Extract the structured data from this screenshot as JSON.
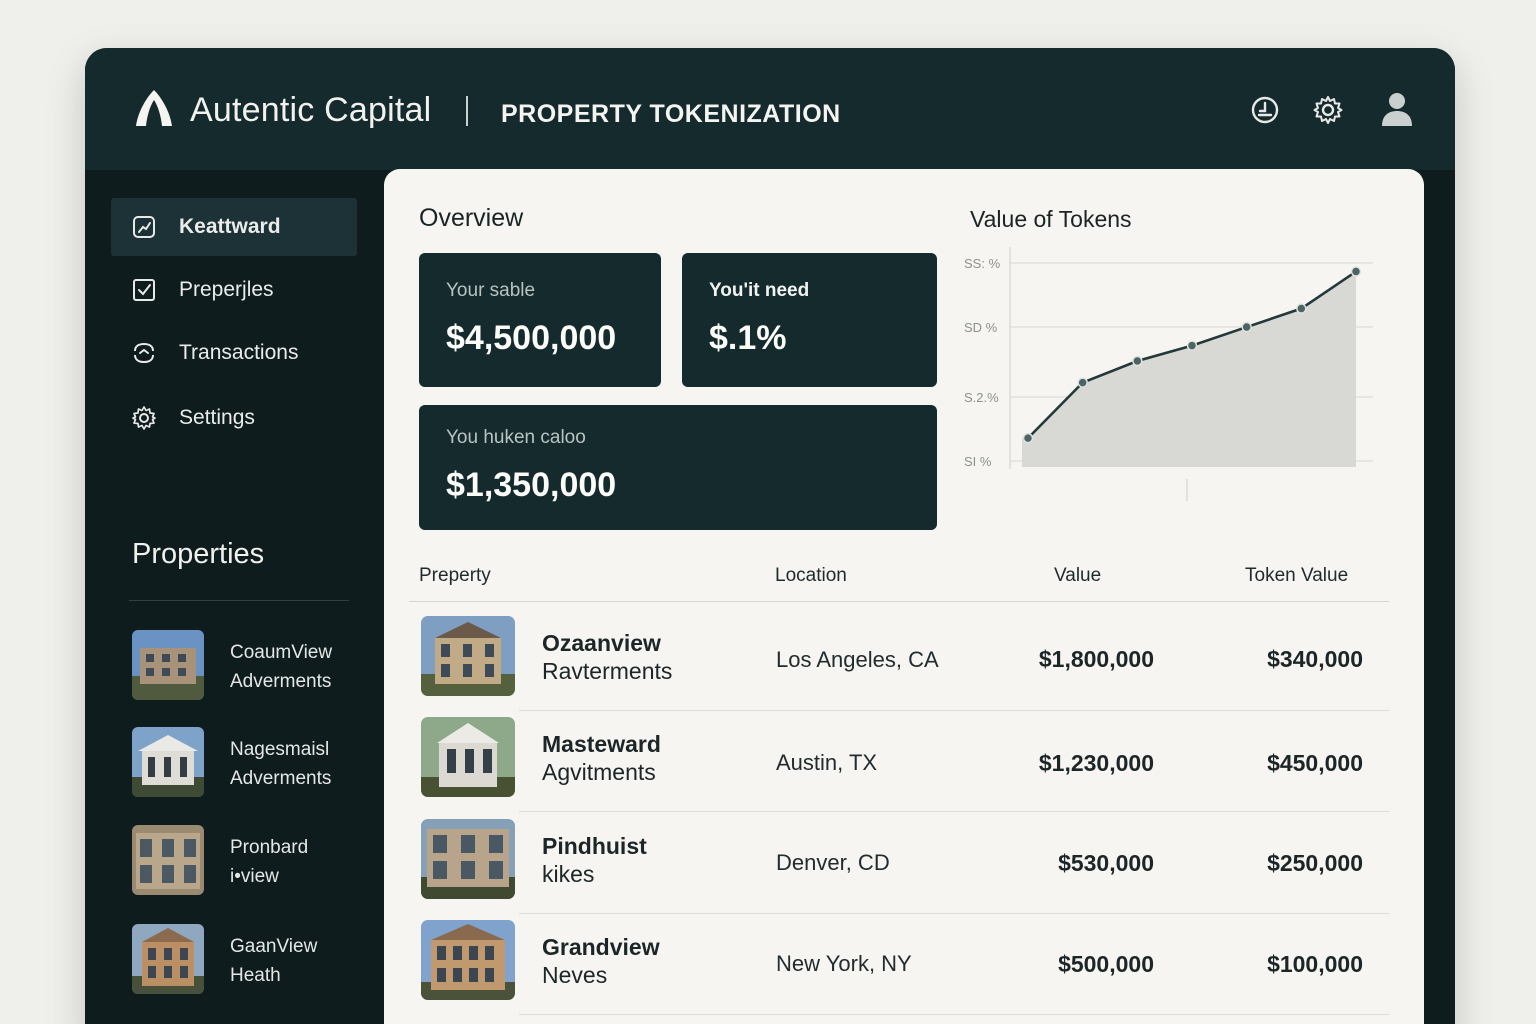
{
  "header": {
    "brand": "Autentic Capital",
    "section": "PROPERTY TOKENIZATION",
    "icons": [
      "clock-icon",
      "gear-icon",
      "user-icon"
    ]
  },
  "sidebar": {
    "nav": [
      {
        "label": "Keattward",
        "icon": "dashboard-icon",
        "active": true
      },
      {
        "label": "Preperjles",
        "icon": "checkbox-icon",
        "active": false
      },
      {
        "label": "Transactions",
        "icon": "exchange-icon",
        "active": false
      },
      {
        "label": "Settings",
        "icon": "gear-icon",
        "active": false
      }
    ],
    "properties_heading": "Properties",
    "properties": [
      {
        "line1": "CoaumView",
        "line2": "Adverments"
      },
      {
        "line1": "Nagesmaisl",
        "line2": "Adverments"
      },
      {
        "line1": "Pronbard",
        "line2": "i•view"
      },
      {
        "line1": "GaanView",
        "line2": "Heath"
      }
    ]
  },
  "overview": {
    "title": "Overview",
    "cards": [
      {
        "label": "Your  sable",
        "value": "$4,500,000"
      },
      {
        "label": "You'it need",
        "value": "$.1%"
      },
      {
        "label": "You huken caloo",
        "value": "$1,350,000"
      }
    ]
  },
  "chart_data": {
    "type": "area",
    "title": "Value of Tokens",
    "y_tick_labels": [
      "SS: %",
      "SD %",
      "S.2.%",
      "SI %"
    ],
    "values": [
      1.0,
      2.8,
      3.5,
      4.0,
      4.6,
      5.2,
      6.4
    ],
    "ylim": [
      0,
      7
    ],
    "grid": true,
    "colors": {
      "line": "#24393b",
      "fill": "#d4d6d2",
      "marker": "#4d6364"
    }
  },
  "table": {
    "headers": {
      "property": "Preperty",
      "location": "Location",
      "value": "Value",
      "token_value": "Token Value"
    },
    "rows": [
      {
        "name1": "Ozaanview",
        "name2": "Ravterments",
        "location": "Los Angeles, CA",
        "value": "$1,800,000",
        "token_value": "$340,000"
      },
      {
        "name1": "Masteward",
        "name2": "Agvitments",
        "location": "Austin, TX",
        "value": "$1,230,000",
        "token_value": "$450,000"
      },
      {
        "name1": "Pindhuist",
        "name2": "kikes",
        "location": "Denver, CD",
        "value": "$530,000",
        "token_value": "$250,000"
      },
      {
        "name1": "Grandview",
        "name2": "Neves",
        "location": "New York, NY",
        "value": "$500,000",
        "token_value": "$100,000"
      }
    ]
  }
}
